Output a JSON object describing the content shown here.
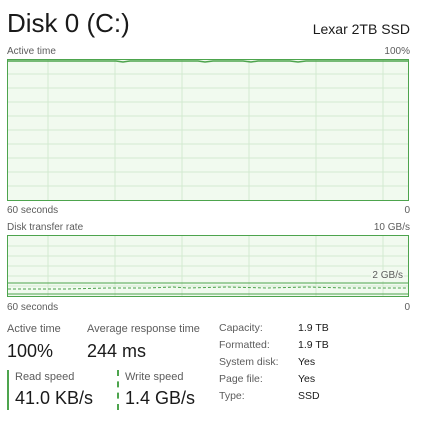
{
  "header": {
    "title": "Disk 0 (C:)",
    "model": "Lexar 2TB SSD"
  },
  "active_time_graph": {
    "label": "Active time",
    "max_label": "100%",
    "time_label": "60 seconds",
    "min_label": "0"
  },
  "transfer_graph": {
    "label": "Disk transfer rate",
    "max_label": "10 GB/s",
    "mid_label": "2 GB/s",
    "time_label": "60 seconds",
    "min_label": "0"
  },
  "stats": {
    "active_time": {
      "label": "Active time",
      "value": "100%"
    },
    "avg_response": {
      "label": "Average response time",
      "value": "244 ms"
    },
    "read_speed": {
      "label": "Read speed",
      "value": "41.0 KB/s"
    },
    "write_speed": {
      "label": "Write speed",
      "value": "1.4 GB/s"
    }
  },
  "properties": [
    {
      "key": "Capacity:",
      "value": "1.9 TB"
    },
    {
      "key": "Formatted:",
      "value": "1.9 TB"
    },
    {
      "key": "System disk:",
      "value": "Yes"
    },
    {
      "key": "Page file:",
      "value": "Yes"
    },
    {
      "key": "Type:",
      "value": "SSD"
    }
  ],
  "colors": {
    "accent": "#4da44d",
    "graph_fill": "#f1faef",
    "grid": "#cfe8cb"
  }
}
